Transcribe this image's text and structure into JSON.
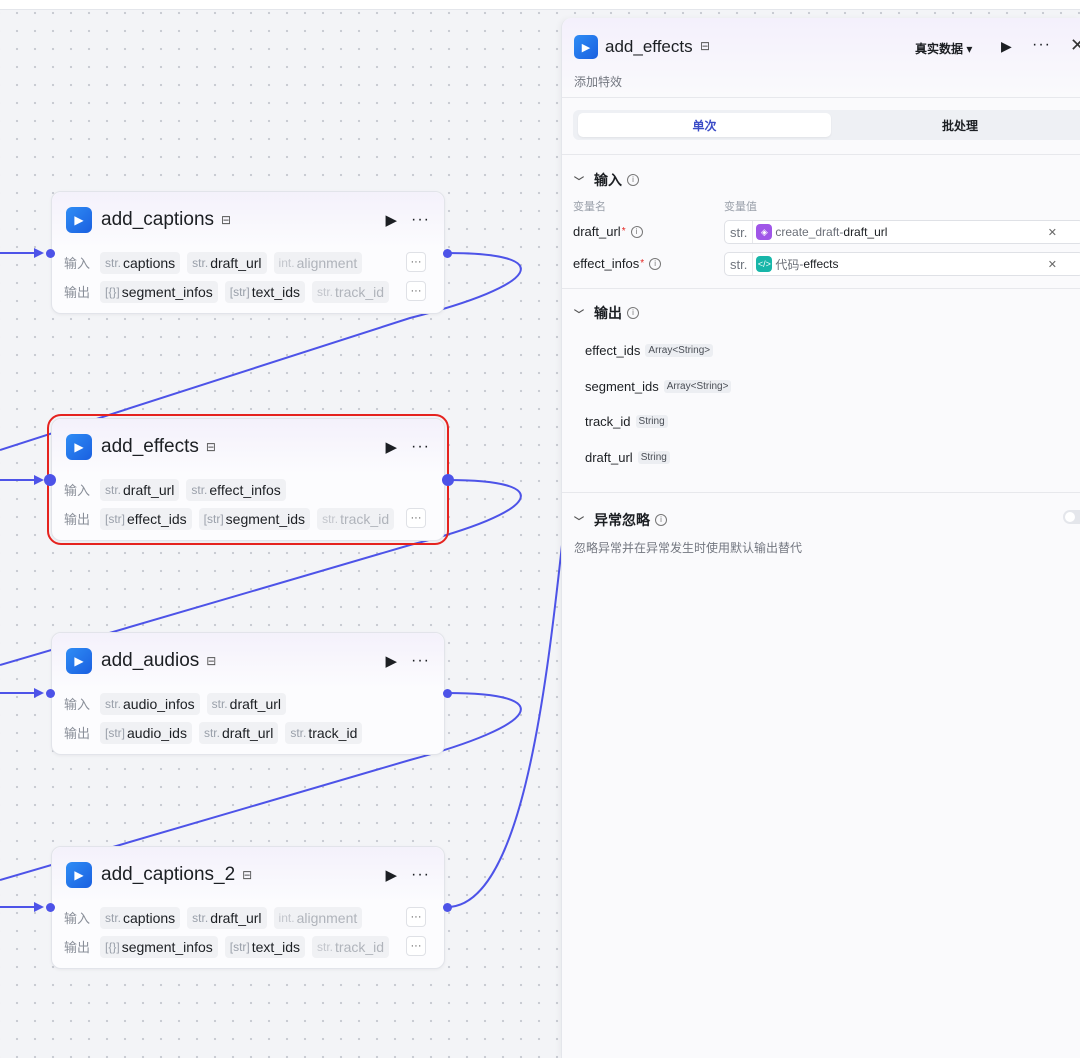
{
  "nodes": [
    {
      "title": "add_captions",
      "input_label": "输入",
      "output_label": "输出",
      "inputs": [
        {
          "type": "str.",
          "name": "captions"
        },
        {
          "type": "str.",
          "name": "draft_url"
        },
        {
          "type": "int.",
          "name": "alignment"
        }
      ],
      "outputs": [
        {
          "type": "[{}]",
          "name": "segment_infos"
        },
        {
          "type": "[str]",
          "name": "text_ids"
        },
        {
          "type": "str.",
          "name": "track_id"
        }
      ]
    },
    {
      "title": "add_effects",
      "selected": true,
      "input_label": "输入",
      "output_label": "输出",
      "inputs": [
        {
          "type": "str.",
          "name": "draft_url"
        },
        {
          "type": "str.",
          "name": "effect_infos"
        }
      ],
      "outputs": [
        {
          "type": "[str]",
          "name": "effect_ids"
        },
        {
          "type": "[str]",
          "name": "segment_ids"
        },
        {
          "type": "str.",
          "name": "track_id"
        }
      ]
    },
    {
      "title": "add_audios",
      "input_label": "输入",
      "output_label": "输出",
      "inputs": [
        {
          "type": "str.",
          "name": "audio_infos"
        },
        {
          "type": "str.",
          "name": "draft_url"
        }
      ],
      "outputs": [
        {
          "type": "[str]",
          "name": "audio_ids"
        },
        {
          "type": "str.",
          "name": "draft_url"
        },
        {
          "type": "str.",
          "name": "track_id"
        }
      ]
    },
    {
      "title": "add_captions_2",
      "input_label": "输入",
      "output_label": "输出",
      "inputs": [
        {
          "type": "str.",
          "name": "captions"
        },
        {
          "type": "str.",
          "name": "draft_url"
        },
        {
          "type": "int.",
          "name": "alignment"
        }
      ],
      "outputs": [
        {
          "type": "[{}]",
          "name": "segment_infos"
        },
        {
          "type": "[str]",
          "name": "text_ids"
        },
        {
          "type": "str.",
          "name": "track_id"
        }
      ]
    }
  ],
  "panel": {
    "title": "add_effects",
    "description": "添加特效",
    "mode_label": "真实数据",
    "tabs": [
      "单次",
      "批处理"
    ],
    "input_section": {
      "title": "输入",
      "col_name": "变量名",
      "col_value": "变量值",
      "vars": [
        {
          "name": "draft_url",
          "type": "str.",
          "source_node": "create_draft",
          "source_sep": " - ",
          "source_field": "draft_url",
          "source_icon": "cube-icon"
        },
        {
          "name": "effect_infos",
          "type": "str.",
          "source_node": "代码",
          "source_sep": " - ",
          "source_field": "effects",
          "source_icon": "code-icon"
        }
      ]
    },
    "output_section": {
      "title": "输出",
      "items": [
        {
          "name": "effect_ids",
          "type": "Array<String>"
        },
        {
          "name": "segment_ids",
          "type": "Array<String>"
        },
        {
          "name": "track_id",
          "type": "String"
        },
        {
          "name": "draft_url",
          "type": "String"
        }
      ]
    },
    "exception_section": {
      "title": "异常忽略",
      "description": "忽略异常并在异常发生时使用默认输出替代",
      "enabled": false
    }
  },
  "colors": {
    "wire": "#4d53e8",
    "selection": "#e5231f",
    "accent": "#3b4cc7"
  }
}
